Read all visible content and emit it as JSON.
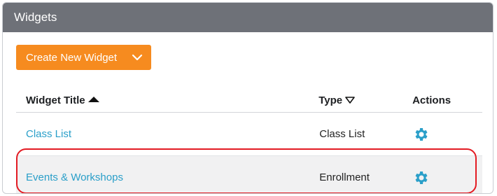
{
  "panel": {
    "title": "Widgets"
  },
  "toolbar": {
    "create_label": "Create New Widget",
    "create_color": "#f68b1f"
  },
  "table": {
    "columns": [
      {
        "label": "Widget Title",
        "sort": "ascending"
      },
      {
        "label": "Type",
        "sort": "descending-available"
      },
      {
        "label": "Actions"
      }
    ],
    "rows": [
      {
        "title": "Class List",
        "type": "Class List",
        "action_icon": "gear-icon"
      },
      {
        "title": "Events & Workshops",
        "type": "Enrollment",
        "action_icon": "gear-icon"
      }
    ]
  },
  "colors": {
    "header_bg": "#6e7178",
    "link": "#2a9fc9",
    "gear": "#2a9fc9",
    "highlight": "#e31b23"
  }
}
